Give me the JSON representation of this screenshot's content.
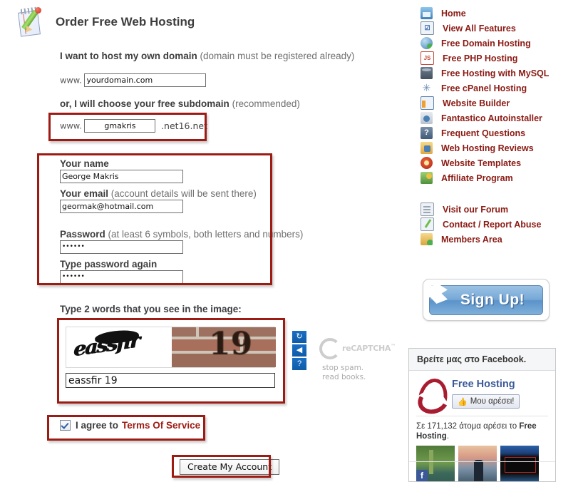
{
  "page": {
    "title": "Order Free Web Hosting",
    "header_icon": "notepad-pencil-icon"
  },
  "form": {
    "own_domain": {
      "heading_bold": "I want to host my own domain",
      "heading_note": "(domain must be registered already)",
      "www_prefix": "www.",
      "value": "yourdomain.com"
    },
    "subdomain": {
      "heading_bold": "or, I will choose your free subdomain",
      "heading_note": "(recommended)",
      "www_prefix": "www.",
      "value": "gmakris",
      "suffix": ".net16.net"
    },
    "fields": {
      "name_label": "Your name",
      "name_value": "George Makris",
      "email_label": "Your email",
      "email_note": "(account details will be sent there)",
      "email_value": "geormak@hotmail.com",
      "password_label": "Password",
      "password_note": "(at least 6 symbols, both letters and numbers)",
      "password_value": "••••••",
      "password_confirm_label": "Type password again",
      "password_confirm_value": "••••••"
    },
    "captcha": {
      "heading": "Type 2 words that you see in the image:",
      "word_image_text": "eassfir",
      "number_image_text": "19",
      "answer_value": "eassfir 19",
      "refresh_icon": "↻",
      "audio_icon": "◀",
      "help_icon": "?",
      "brand": "reCAPTCHA",
      "brand_tm": "™",
      "tagline_line1": "stop spam.",
      "tagline_line2": "read books."
    },
    "terms": {
      "checked": true,
      "text": "I agree to",
      "link": "Terms Of Service"
    },
    "submit_label": "Create My Account"
  },
  "sidebar": {
    "primary_links": [
      {
        "label": "Home",
        "icon": "home-icon",
        "icon_class": "ic-home",
        "glyph": ""
      },
      {
        "label": "View All Features",
        "icon": "checklist-icon",
        "icon_class": "ic-check",
        "glyph": "☑"
      },
      {
        "label": "Free Domain Hosting",
        "icon": "globe-icon",
        "icon_class": "ic-globe",
        "glyph": ""
      },
      {
        "label": "Free PHP Hosting",
        "icon": "php-script-icon",
        "icon_class": "ic-js",
        "glyph": "JS"
      },
      {
        "label": "Free Hosting with MySQL",
        "icon": "database-icon",
        "icon_class": "ic-db",
        "glyph": ""
      },
      {
        "label": "Free cPanel Hosting",
        "icon": "cpanel-star-icon",
        "icon_class": "ic-star",
        "glyph": "✳"
      },
      {
        "label": "Website Builder",
        "icon": "layout-icon",
        "icon_class": "ic-layout",
        "glyph": ""
      },
      {
        "label": "Fantastico Autoinstaller",
        "icon": "installer-icon",
        "icon_class": "ic-fanta",
        "glyph": ""
      },
      {
        "label": "Frequent Questions",
        "icon": "question-icon",
        "icon_class": "ic-quest",
        "glyph": "?"
      },
      {
        "label": "Web Hosting Reviews",
        "icon": "folder-review-icon",
        "icon_class": "ic-review",
        "glyph": ""
      },
      {
        "label": "Website Templates",
        "icon": "template-target-icon",
        "icon_class": "ic-tmpl",
        "glyph": ""
      },
      {
        "label": "Affiliate Program",
        "icon": "money-icon",
        "icon_class": "ic-money",
        "glyph": ""
      }
    ],
    "secondary_links": [
      {
        "label": "Visit our Forum",
        "icon": "forum-icon",
        "icon_class": "ic-forum",
        "glyph": ""
      },
      {
        "label": "Contact / Report Abuse",
        "icon": "contact-pencil-icon",
        "icon_class": "ic-contact",
        "glyph": ""
      },
      {
        "label": "Members Area",
        "icon": "lock-icon",
        "icon_class": "ic-lock",
        "glyph": ""
      }
    ],
    "signup_label": "Sign Up!",
    "signup_ribbon_icon": "star-burst-icon"
  },
  "facebook": {
    "header": "Βρείτε μας στο Facebook.",
    "page_name": "Free Hosting",
    "like_button": "Μου αρέσει!",
    "like_thumb_icon": "thumbs-up-icon",
    "count_prefix": "Σε 171,132 άτομα αρέσει το",
    "count_page": "Free Hosting",
    "count_suffix": ".",
    "badge": "f"
  },
  "colors": {
    "link": "#8b1a13",
    "annotation": "#9e1b14",
    "facebook_blue": "#3b5998",
    "recaptcha_gray": "#cdcdcd"
  }
}
